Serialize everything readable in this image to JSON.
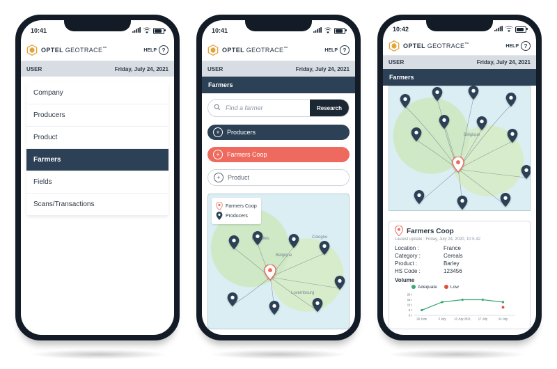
{
  "status": {
    "time_a": "10:41",
    "time_b": "10:41",
    "time_c": "10:42"
  },
  "brand": {
    "name_a": "OPTEL",
    "name_b": "GEOTRACE",
    "tm": "™"
  },
  "help_label": "HELP",
  "userbar": {
    "user": "USER",
    "date": "Friday, July 24, 2021"
  },
  "section_title": "Farmers",
  "menu": [
    {
      "label": "Company"
    },
    {
      "label": "Producers"
    },
    {
      "label": "Product"
    },
    {
      "label": "Farmers"
    },
    {
      "label": "Fields"
    },
    {
      "label": "Scans/Transactions"
    }
  ],
  "search": {
    "placeholder": "Find a farmer",
    "button": "Research"
  },
  "pills": [
    {
      "label": "Producers",
      "style": "navy"
    },
    {
      "label": "Farmers Coop",
      "style": "coral"
    },
    {
      "label": "Product",
      "style": "outline"
    }
  ],
  "legend": {
    "a": "Farmers Coop",
    "b": "Producers"
  },
  "maplabels": {
    "br": "Bruxelles",
    "be": "Belgique",
    "co": "Cologne",
    "lu": "Luxembourg"
  },
  "card": {
    "title": "Farmers Coop",
    "sub": "Lastest update : Friday, July 24, 2020, 10 h 42",
    "kv": [
      {
        "k": "Location :",
        "v": "France"
      },
      {
        "k": "Category :",
        "v": "Cereals"
      },
      {
        "k": "Product :",
        "v": "Barley"
      },
      {
        "k": "HS Code :",
        "v": "123456"
      }
    ],
    "volume_label": "Volume",
    "legend_a": "Adequate",
    "legend_b": "Low"
  },
  "chart_data": {
    "type": "line",
    "title": "Volume",
    "xlabel": "",
    "ylabel": "",
    "ylim": [
      0,
      20
    ],
    "y_ticks": [
      "20 t",
      "15 t",
      "10 t",
      "5 t",
      "0 t"
    ],
    "categories": [
      "26 June",
      "3 July",
      "10 July 2021",
      "17 July",
      "24 July"
    ],
    "series": [
      {
        "name": "Adequate",
        "values": [
          5,
          13,
          15,
          15,
          13
        ]
      },
      {
        "name": "Low",
        "values": [
          null,
          null,
          null,
          null,
          8
        ]
      }
    ]
  }
}
